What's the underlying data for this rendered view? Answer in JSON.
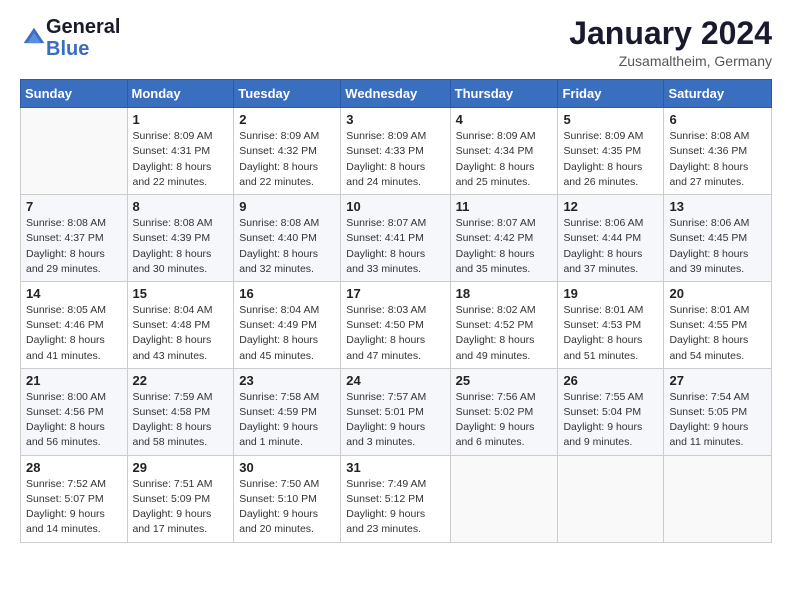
{
  "header": {
    "logo_line1": "General",
    "logo_line2": "Blue",
    "main_title": "January 2024",
    "subtitle": "Zusamaltheim, Germany"
  },
  "calendar": {
    "days_of_week": [
      "Sunday",
      "Monday",
      "Tuesday",
      "Wednesday",
      "Thursday",
      "Friday",
      "Saturday"
    ],
    "weeks": [
      [
        {
          "num": "",
          "info": ""
        },
        {
          "num": "1",
          "info": "Sunrise: 8:09 AM\nSunset: 4:31 PM\nDaylight: 8 hours\nand 22 minutes."
        },
        {
          "num": "2",
          "info": "Sunrise: 8:09 AM\nSunset: 4:32 PM\nDaylight: 8 hours\nand 22 minutes."
        },
        {
          "num": "3",
          "info": "Sunrise: 8:09 AM\nSunset: 4:33 PM\nDaylight: 8 hours\nand 24 minutes."
        },
        {
          "num": "4",
          "info": "Sunrise: 8:09 AM\nSunset: 4:34 PM\nDaylight: 8 hours\nand 25 minutes."
        },
        {
          "num": "5",
          "info": "Sunrise: 8:09 AM\nSunset: 4:35 PM\nDaylight: 8 hours\nand 26 minutes."
        },
        {
          "num": "6",
          "info": "Sunrise: 8:08 AM\nSunset: 4:36 PM\nDaylight: 8 hours\nand 27 minutes."
        }
      ],
      [
        {
          "num": "7",
          "info": "Sunrise: 8:08 AM\nSunset: 4:37 PM\nDaylight: 8 hours\nand 29 minutes."
        },
        {
          "num": "8",
          "info": "Sunrise: 8:08 AM\nSunset: 4:39 PM\nDaylight: 8 hours\nand 30 minutes."
        },
        {
          "num": "9",
          "info": "Sunrise: 8:08 AM\nSunset: 4:40 PM\nDaylight: 8 hours\nand 32 minutes."
        },
        {
          "num": "10",
          "info": "Sunrise: 8:07 AM\nSunset: 4:41 PM\nDaylight: 8 hours\nand 33 minutes."
        },
        {
          "num": "11",
          "info": "Sunrise: 8:07 AM\nSunset: 4:42 PM\nDaylight: 8 hours\nand 35 minutes."
        },
        {
          "num": "12",
          "info": "Sunrise: 8:06 AM\nSunset: 4:44 PM\nDaylight: 8 hours\nand 37 minutes."
        },
        {
          "num": "13",
          "info": "Sunrise: 8:06 AM\nSunset: 4:45 PM\nDaylight: 8 hours\nand 39 minutes."
        }
      ],
      [
        {
          "num": "14",
          "info": "Sunrise: 8:05 AM\nSunset: 4:46 PM\nDaylight: 8 hours\nand 41 minutes."
        },
        {
          "num": "15",
          "info": "Sunrise: 8:04 AM\nSunset: 4:48 PM\nDaylight: 8 hours\nand 43 minutes."
        },
        {
          "num": "16",
          "info": "Sunrise: 8:04 AM\nSunset: 4:49 PM\nDaylight: 8 hours\nand 45 minutes."
        },
        {
          "num": "17",
          "info": "Sunrise: 8:03 AM\nSunset: 4:50 PM\nDaylight: 8 hours\nand 47 minutes."
        },
        {
          "num": "18",
          "info": "Sunrise: 8:02 AM\nSunset: 4:52 PM\nDaylight: 8 hours\nand 49 minutes."
        },
        {
          "num": "19",
          "info": "Sunrise: 8:01 AM\nSunset: 4:53 PM\nDaylight: 8 hours\nand 51 minutes."
        },
        {
          "num": "20",
          "info": "Sunrise: 8:01 AM\nSunset: 4:55 PM\nDaylight: 8 hours\nand 54 minutes."
        }
      ],
      [
        {
          "num": "21",
          "info": "Sunrise: 8:00 AM\nSunset: 4:56 PM\nDaylight: 8 hours\nand 56 minutes."
        },
        {
          "num": "22",
          "info": "Sunrise: 7:59 AM\nSunset: 4:58 PM\nDaylight: 8 hours\nand 58 minutes."
        },
        {
          "num": "23",
          "info": "Sunrise: 7:58 AM\nSunset: 4:59 PM\nDaylight: 9 hours\nand 1 minute."
        },
        {
          "num": "24",
          "info": "Sunrise: 7:57 AM\nSunset: 5:01 PM\nDaylight: 9 hours\nand 3 minutes."
        },
        {
          "num": "25",
          "info": "Sunrise: 7:56 AM\nSunset: 5:02 PM\nDaylight: 9 hours\nand 6 minutes."
        },
        {
          "num": "26",
          "info": "Sunrise: 7:55 AM\nSunset: 5:04 PM\nDaylight: 9 hours\nand 9 minutes."
        },
        {
          "num": "27",
          "info": "Sunrise: 7:54 AM\nSunset: 5:05 PM\nDaylight: 9 hours\nand 11 minutes."
        }
      ],
      [
        {
          "num": "28",
          "info": "Sunrise: 7:52 AM\nSunset: 5:07 PM\nDaylight: 9 hours\nand 14 minutes."
        },
        {
          "num": "29",
          "info": "Sunrise: 7:51 AM\nSunset: 5:09 PM\nDaylight: 9 hours\nand 17 minutes."
        },
        {
          "num": "30",
          "info": "Sunrise: 7:50 AM\nSunset: 5:10 PM\nDaylight: 9 hours\nand 20 minutes."
        },
        {
          "num": "31",
          "info": "Sunrise: 7:49 AM\nSunset: 5:12 PM\nDaylight: 9 hours\nand 23 minutes."
        },
        {
          "num": "",
          "info": ""
        },
        {
          "num": "",
          "info": ""
        },
        {
          "num": "",
          "info": ""
        }
      ]
    ]
  }
}
